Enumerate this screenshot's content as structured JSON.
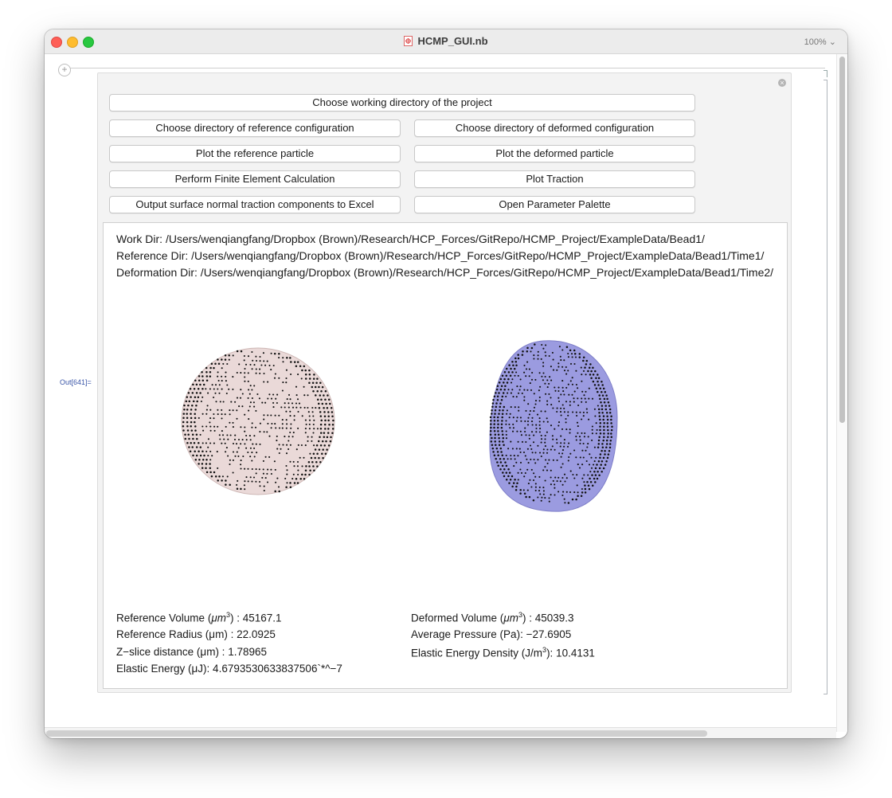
{
  "window": {
    "title": "HCMP_GUI.nb",
    "zoom": "100%"
  },
  "notebook": {
    "add_cell": "+",
    "out_label": "Out[641]=",
    "close": "×"
  },
  "buttons": {
    "working_dir": "Choose working directory of the project",
    "ref_dir": "Choose directory of reference configuration",
    "def_dir": "Choose directory of deformed configuration",
    "plot_ref": "Plot the reference particle",
    "plot_def": "Plot the deformed particle",
    "fe_calc": "Perform Finite Element Calculation",
    "plot_traction": "Plot Traction",
    "output_excel": "Output surface normal traction components to Excel",
    "open_palette": "Open Parameter Palette"
  },
  "dirs": {
    "work": "Work Dir: /Users/wenqiangfang/Dropbox (Brown)/Research/HCP_Forces/GitRepo/HCMP_Project/ExampleData/Bead1/",
    "reference": "Reference Dir: /Users/wenqiangfang/Dropbox (Brown)/Research/HCP_Forces/GitRepo/HCMP_Project/ExampleData/Bead1/Time1/",
    "deformation": "Deformation Dir: /Users/wenqiangfang/Dropbox (Brown)/Research/HCP_Forces/GitRepo/HCMP_Project/ExampleData/Bead1/Time2/"
  },
  "stats": {
    "ref_volume_label": "Reference Volume (",
    "ref_volume_unit": "μm",
    "ref_volume_exp": "3",
    "ref_volume_value": ") : 45167.1",
    "ref_radius": "Reference Radius (μm) : 22.0925",
    "zslice": "Z−slice distance (μm) : 1.78965",
    "elastic_energy": "Elastic Energy (μJ): 4.6793530633837506`*^−7",
    "def_volume_label": "Deformed Volume (",
    "def_volume_unit": "μm",
    "def_volume_exp": "3",
    "def_volume_value": ") : 45039.3",
    "avg_pressure": "Average Pressure (Pa): −27.6905",
    "energy_density_label": "Elastic Energy Density (J/m",
    "energy_density_exp": "3",
    "energy_density_value": "): 10.4131"
  },
  "colors": {
    "reference_particle": "#ead9d8",
    "deformed_particle": "#9b9be0",
    "accent_text": "#3a56a8"
  }
}
